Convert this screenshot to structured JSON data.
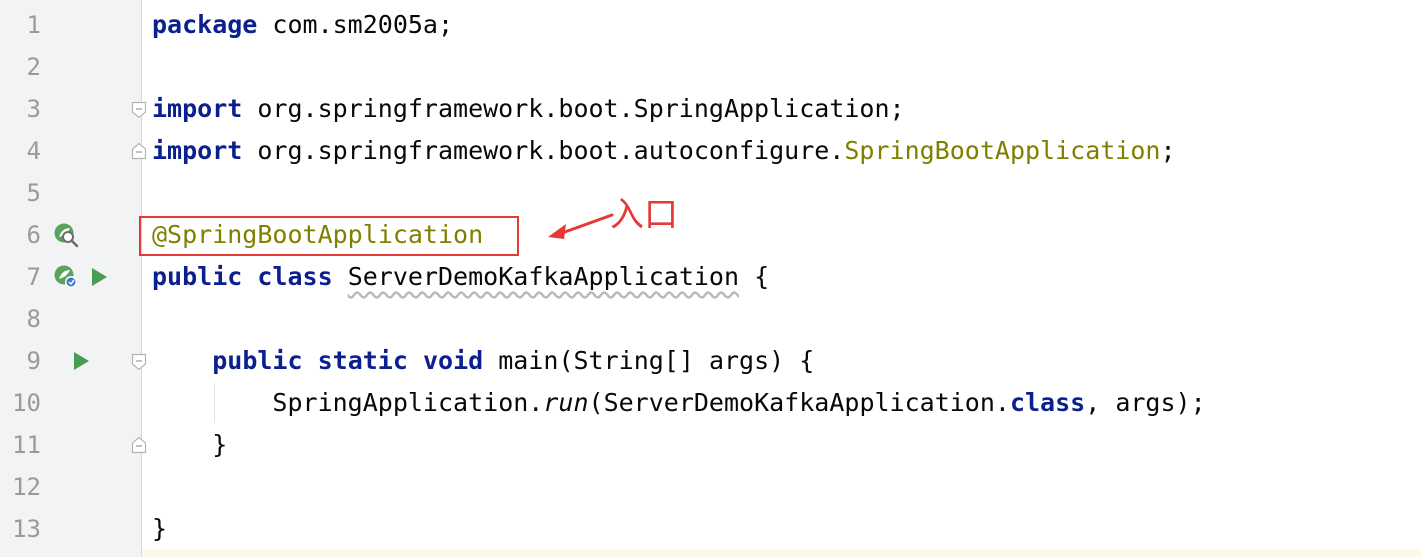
{
  "editor": {
    "line_numbers": [
      "1",
      "2",
      "3",
      "4",
      "5",
      "6",
      "7",
      "8",
      "9",
      "10",
      "11",
      "12",
      "13"
    ],
    "lines": {
      "l1": {
        "kw": "package",
        "rest": " com.sm2005a;"
      },
      "l3": {
        "kw": "import",
        "rest": " org.springframework.boot.SpringApplication;"
      },
      "l4": {
        "kw": "import",
        "rest": " org.springframework.boot.autoconfigure.",
        "anno": "SpringBootApplication",
        "end": ";"
      },
      "l6": {
        "anno": "@SpringBootApplication"
      },
      "l7": {
        "kw1": "public",
        "kw2": "class",
        "name": "ServerDemoKafkaApplication",
        "end": " {"
      },
      "l9": {
        "kw1": "public",
        "kw2": "static",
        "kw3": "void",
        "rest": " main(String[] args) {"
      },
      "l10": {
        "pre": "SpringApplication.",
        "call": "run",
        "mid": "(ServerDemoKafkaApplication.",
        "kw": "class",
        "end": ", args);"
      },
      "l11": {
        "text": "}"
      },
      "l13": {
        "text": "}"
      }
    },
    "gutter_icons": {
      "line6": "spring-bean-search-icon",
      "line7": [
        "spring-bean-icon",
        "run-arrow-icon"
      ],
      "line9": "run-arrow-icon"
    }
  },
  "annotation_callout": {
    "label": "入口",
    "color": "#e53935"
  },
  "colors": {
    "keyword": "#0b1f8f",
    "annotation": "#808000",
    "gutter_bg": "#f2f3f5",
    "line_number": "#9a9a9a",
    "run_icon": "#499c54"
  }
}
